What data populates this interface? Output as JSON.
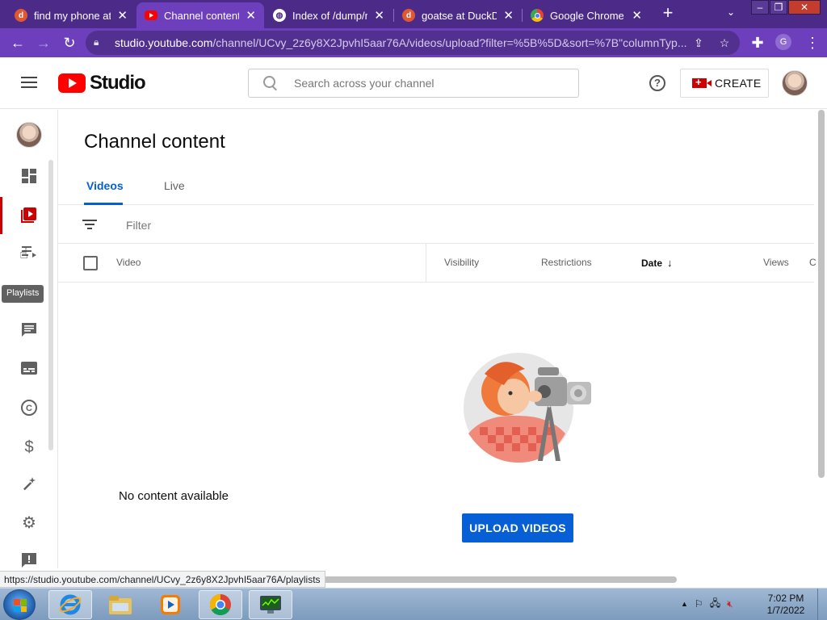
{
  "browser": {
    "tabs": [
      {
        "title": "find my phone at",
        "favicon": "duckduckgo-icon",
        "active": false
      },
      {
        "title": "Channel content -",
        "favicon": "youtube-icon",
        "active": true
      },
      {
        "title": "Index of /dump/m",
        "favicon": "globe-icon",
        "active": false
      },
      {
        "title": "goatse at DuckDu",
        "favicon": "duckduckgo-icon",
        "active": false
      },
      {
        "title": "Google Chrome H",
        "favicon": "google-icon",
        "active": false
      }
    ],
    "url_host": "studio.youtube.com",
    "url_path": "/channel/UCvy_2z6y8X2JpvhI5aar76A/videos/upload?filter=%5B%5D&sort=%7B\"columnTyp...",
    "profile_initial": "G"
  },
  "header": {
    "logo_text": "Studio",
    "search_placeholder": "Search across your channel",
    "help_symbol": "?",
    "create_label": "CREATE"
  },
  "leftnav": {
    "items": [
      {
        "name": "dashboard",
        "icon": "dashboard-icon",
        "active": false
      },
      {
        "name": "content",
        "icon": "content-icon",
        "active": true
      },
      {
        "name": "playlists",
        "icon": "playlists-icon",
        "active": false
      },
      {
        "name": "comments",
        "icon": "comments-icon",
        "active": false
      },
      {
        "name": "subtitles",
        "icon": "subtitles-icon",
        "active": false
      },
      {
        "name": "copyright",
        "icon": "copyright-icon",
        "active": false
      },
      {
        "name": "earn",
        "icon": "dollar-icon",
        "active": false
      },
      {
        "name": "customization",
        "icon": "magic-wand-icon",
        "active": false
      },
      {
        "name": "settings",
        "icon": "gear-icon",
        "active": false
      },
      {
        "name": "feedback",
        "icon": "feedback-icon",
        "active": false
      }
    ],
    "tooltip": "Playlists"
  },
  "main": {
    "title": "Channel content",
    "tabs": [
      {
        "label": "Videos",
        "active": true
      },
      {
        "label": "Live",
        "active": false
      }
    ],
    "filter_placeholder": "Filter",
    "columns": [
      "Video",
      "Visibility",
      "Restrictions",
      "Date",
      "Views",
      "C"
    ],
    "sort_column": "Date",
    "sort_direction": "descending",
    "empty_text": "No content available",
    "upload_label": "UPLOAD VIDEOS"
  },
  "status_url": "https://studio.youtube.com/channel/UCvy_2z6y8X2JpvhI5aar76A/playlists",
  "taskbar": {
    "time": "7:02 PM",
    "date": "1/7/2022",
    "apps": [
      "internet-explorer-icon",
      "file-explorer-icon",
      "media-player-icon",
      "chrome-icon",
      "task-manager-icon"
    ]
  },
  "colors": {
    "chrome_frame": "#4b2b87",
    "chrome_toolbar": "#6e3fbd",
    "youtube_red": "#ff0000",
    "accent_blue": "#065fd4",
    "active_nav": "#cc0000"
  }
}
